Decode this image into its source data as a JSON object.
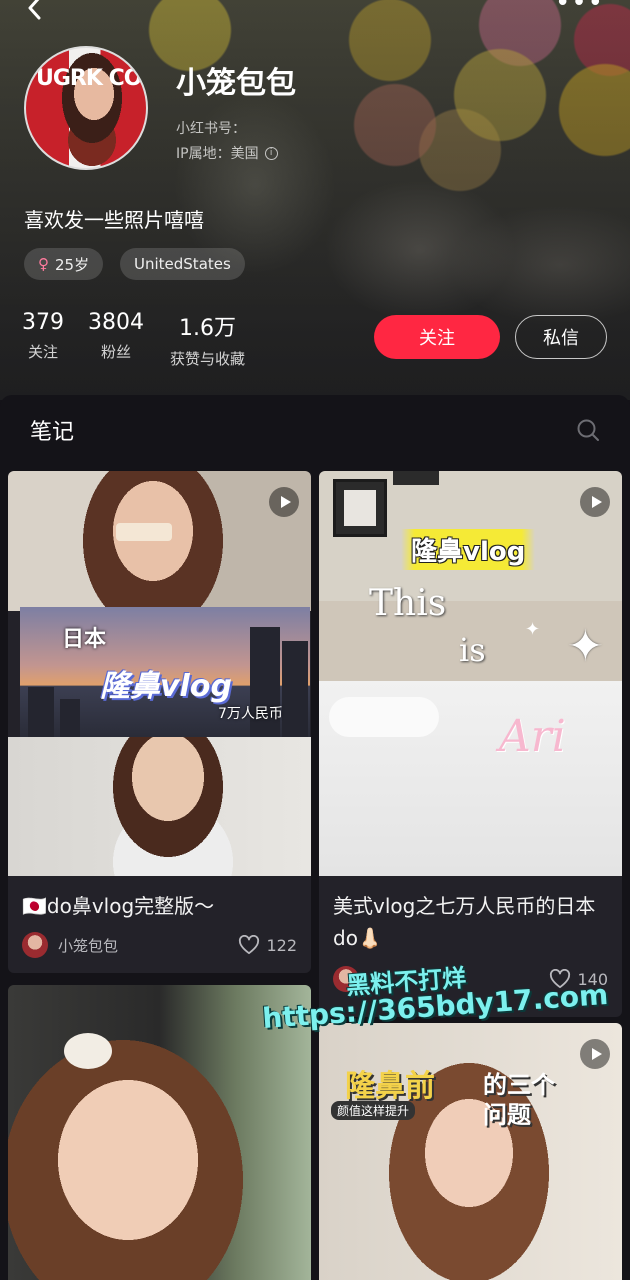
{
  "profile": {
    "username": "小笼包包",
    "rednote_id_label": "小红书号：",
    "ip_location": "IP属地：美国",
    "bio": "喜欢发一些照片嘻嘻",
    "avatar_text": "UGRK CO",
    "tags": {
      "age": "25岁",
      "location": "UnitedStates"
    },
    "stats": {
      "following": {
        "value": "379",
        "label": "关注"
      },
      "followers": {
        "value": "3804",
        "label": "粉丝"
      },
      "likes": {
        "value": "1.6万",
        "label": "获赞与收藏"
      }
    },
    "follow_label": "关注",
    "message_label": "私信"
  },
  "notes": {
    "tab_label": "笔记",
    "cards": [
      {
        "title": "🇯🇵do鼻vlog完整版～",
        "author": "小笼包包",
        "likes": "122",
        "cover_texts": {
          "jp": "日本",
          "vlog": "隆鼻vlog",
          "price": "7万人民币"
        }
      },
      {
        "title": "美式vlog之七万人民币的日本do👃🏻",
        "likes": "140",
        "cover_texts": {
          "title": "隆鼻vlog",
          "this": "This",
          "is": "is",
          "name": "Ari"
        }
      },
      {
        "title": "",
        "cover_texts": {}
      },
      {
        "title": "",
        "cover_texts": {
          "t1": "隆鼻前",
          "t2": "的三个",
          "t3": "问题",
          "sub": "颜值这样提升"
        }
      }
    ]
  },
  "watermark": {
    "line1": "黑料不打烊",
    "line2": "https://365bdy17.com"
  },
  "colors": {
    "accent": "#ff2742",
    "background": "#141318",
    "card": "#232229"
  },
  "icons": [
    "back-arrow-icon",
    "more-icon",
    "info-icon",
    "female-icon",
    "search-icon",
    "play-icon",
    "heart-icon"
  ]
}
